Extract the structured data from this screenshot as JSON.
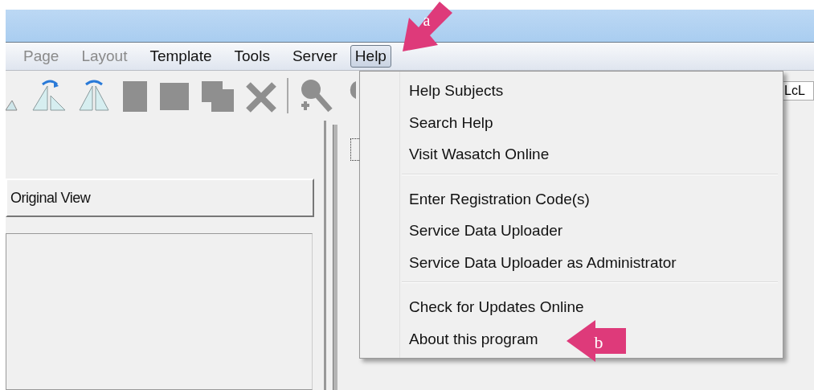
{
  "menu_bar": [
    {
      "label": "Page",
      "disabled": true,
      "selected": false
    },
    {
      "label": "Layout",
      "disabled": true,
      "selected": false
    },
    {
      "label": "Template",
      "disabled": false,
      "selected": false
    },
    {
      "label": "Tools",
      "disabled": false,
      "selected": false
    },
    {
      "label": "Server",
      "disabled": false,
      "selected": false
    },
    {
      "label": "Help",
      "disabled": false,
      "selected": true
    }
  ],
  "toolbar": {
    "field_value": "LcL"
  },
  "left_panel": {
    "button": "Original View"
  },
  "help_menu": {
    "groups": [
      [
        "Help Subjects",
        "Search Help",
        "Visit Wasatch Online"
      ],
      [
        "Enter Registration Code(s)",
        "Service Data Uploader",
        "Service Data Uploader as Administrator"
      ],
      [
        "Check for Updates Online",
        "About this program"
      ]
    ]
  },
  "callouts": [
    {
      "label": "a",
      "kind": "down-left"
    },
    {
      "label": "b",
      "kind": "left"
    }
  ]
}
